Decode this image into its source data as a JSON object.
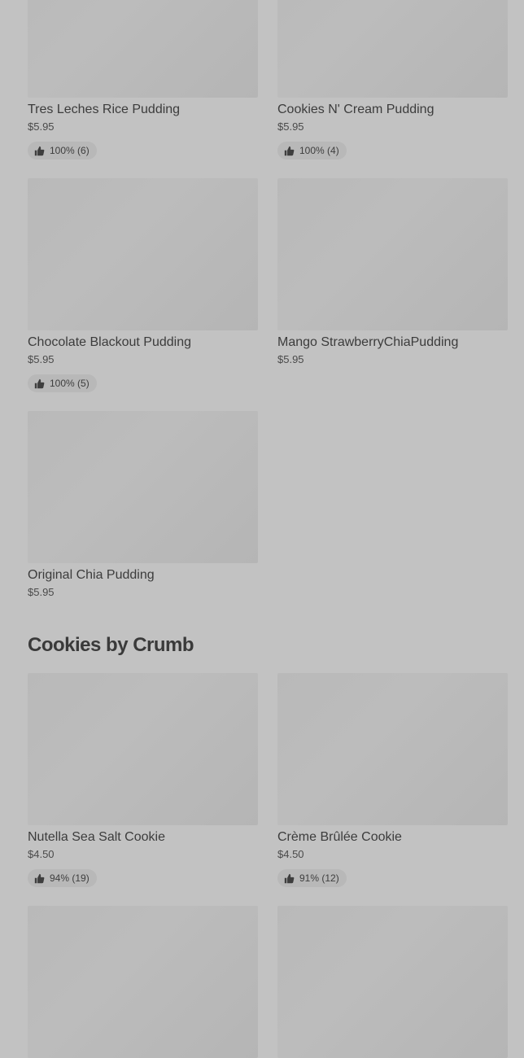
{
  "section_pudding": {
    "items": [
      {
        "name": "Tres Leches Rice Pudding",
        "price": "$5.95",
        "rating": "100% (6)"
      },
      {
        "name": "Cookies N' Cream Pudding",
        "price": "$5.95",
        "rating": "100% (4)"
      },
      {
        "name": "Chocolate Blackout Pudding",
        "price": "$5.95",
        "rating": "100% (5)"
      },
      {
        "name": "Mango StrawberryChiaPudding",
        "price": "$5.95",
        "rating": ""
      },
      {
        "name": "Original Chia Pudding",
        "price": "$5.95",
        "rating": ""
      }
    ]
  },
  "section_cookies": {
    "title": "Cookies by Crumb",
    "items": [
      {
        "name": "Nutella Sea Salt Cookie",
        "price": "$4.50",
        "rating": "94% (19)"
      },
      {
        "name": "Crème Brûlée Cookie",
        "price": "$4.50",
        "rating": "91% (12)"
      }
    ]
  },
  "icons": {
    "rating": "thumbs-up-icon"
  }
}
